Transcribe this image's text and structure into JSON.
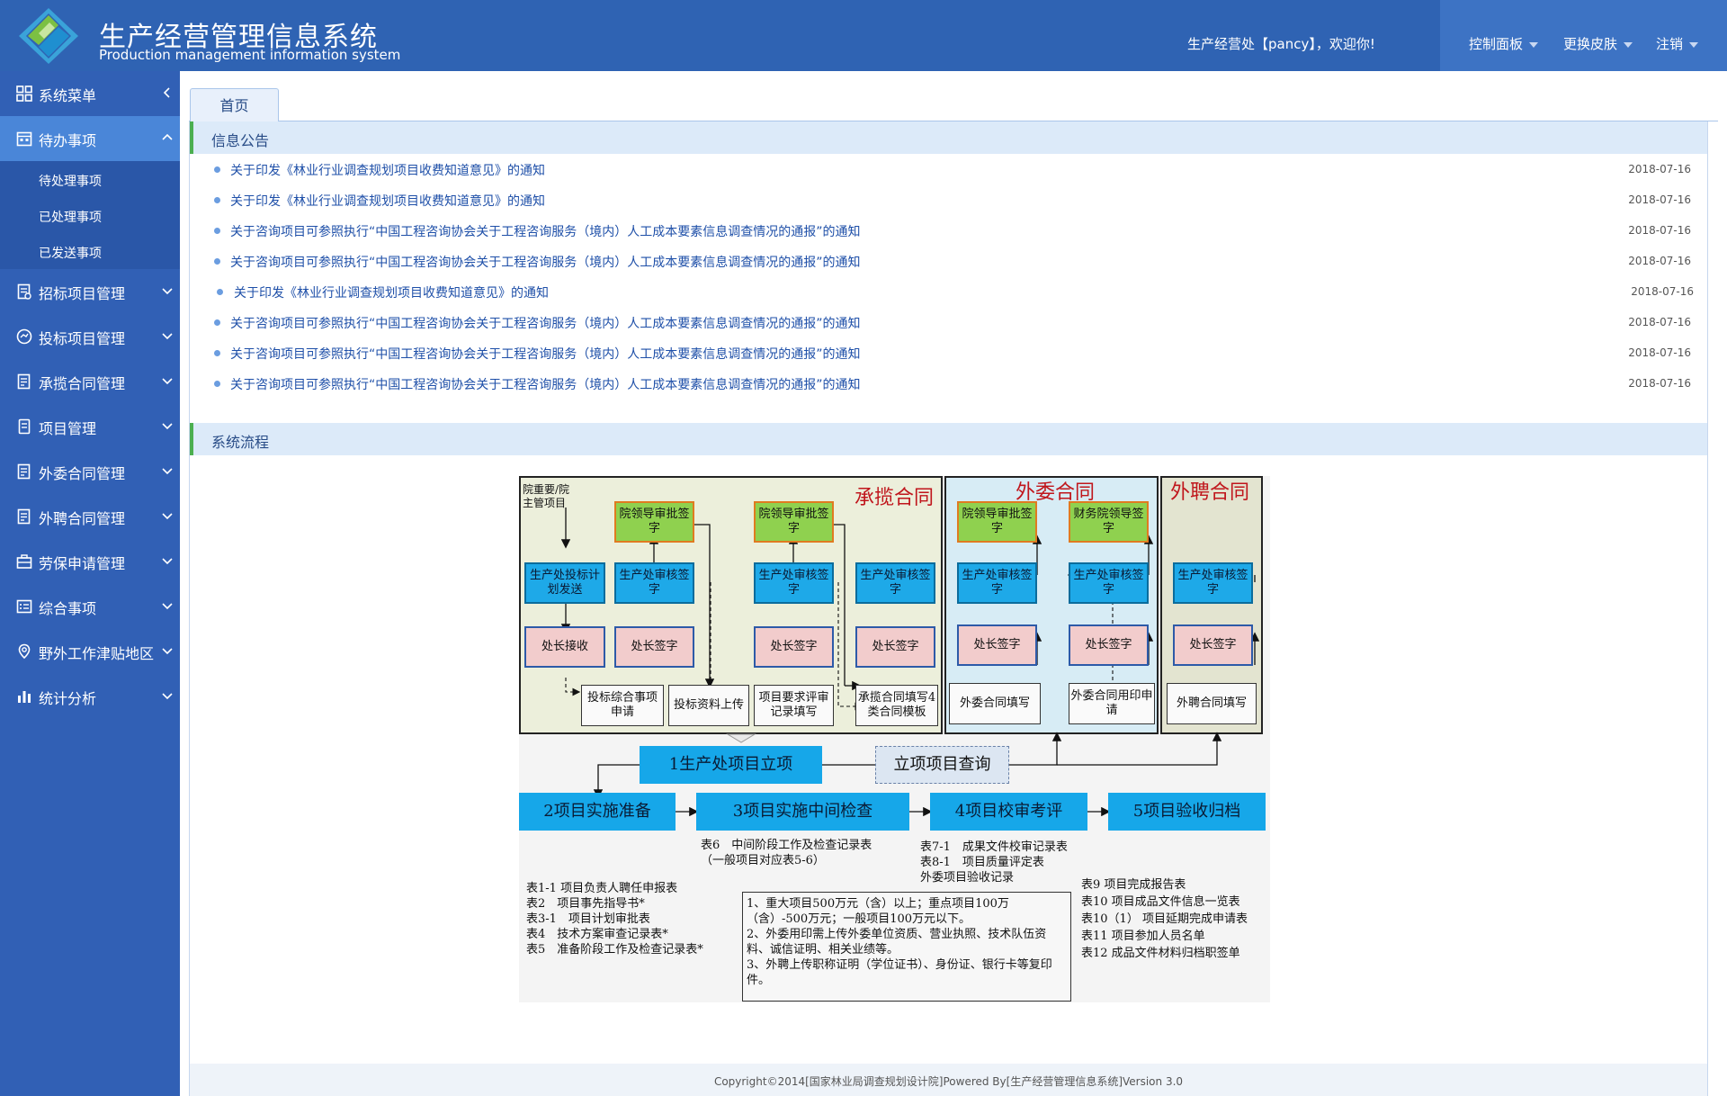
{
  "header": {
    "title": "生产经营管理信息系统",
    "subtitle": "Production management information system",
    "welcome": "生产经营处【pancy】，欢迎你!",
    "menu": [
      "控制面板",
      "更换皮肤",
      "注销"
    ]
  },
  "sidebar": {
    "items": [
      {
        "label": "系统菜单",
        "icon": "grid-icon"
      },
      {
        "label": "待办事项",
        "icon": "calendar-icon"
      },
      {
        "label": "招标项目管理",
        "icon": "document-icon"
      },
      {
        "label": "投标项目管理",
        "icon": "hand-icon"
      },
      {
        "label": "承揽合同管理",
        "icon": "contract-icon"
      },
      {
        "label": "项目管理",
        "icon": "folder-icon"
      },
      {
        "label": "外委合同管理",
        "icon": "contract-icon"
      },
      {
        "label": "外聘合同管理",
        "icon": "contract-icon"
      },
      {
        "label": "劳保申请管理",
        "icon": "briefcase-icon"
      },
      {
        "label": "综合事项",
        "icon": "list-icon"
      },
      {
        "label": "野外工作津贴地区",
        "icon": "location-icon"
      },
      {
        "label": "统计分析",
        "icon": "bar-chart-icon"
      }
    ],
    "sub_items": [
      "待处理事项",
      "已处理事项",
      "已发送事项"
    ]
  },
  "tabs": [
    {
      "label": "首页"
    }
  ],
  "notice": {
    "heading": "信息公告",
    "items": [
      {
        "title": "关于印发《林业行业调查规划项目收费知道意见》的通知",
        "date": "2018-07-16"
      },
      {
        "title": "关于印发《林业行业调查规划项目收费知道意见》的通知",
        "date": "2018-07-16"
      },
      {
        "title": "关于咨询项目可参照执行“中国工程咨询协会关于工程咨询服务（境内）人工成本要素信息调查情况的通报”的通知",
        "date": "2018-07-16"
      },
      {
        "title": "关于咨询项目可参照执行“中国工程咨询协会关于工程咨询服务（境内）人工成本要素信息调查情况的通报”的通知",
        "date": "2018-07-16"
      },
      {
        "title": "关于印发《林业行业调查规划项目收费知道意见》的通知",
        "date": "2018-07-16"
      },
      {
        "title": "关于咨询项目可参照执行“中国工程咨询协会关于工程咨询服务（境内）人工成本要素信息调查情况的通报”的通知",
        "date": "2018-07-16"
      },
      {
        "title": "关于咨询项目可参照执行“中国工程咨询协会关于工程咨询服务（境内）人工成本要素信息调查情况的通报”的通知",
        "date": "2018-07-16"
      },
      {
        "title": "关于咨询项目可参照执行“中国工程咨询协会关于工程咨询服务（境内）人工成本要素信息调查情况的通报”的通知",
        "date": "2018-07-16"
      }
    ]
  },
  "flow": {
    "heading": "系统流程",
    "panels": [
      "承揽合同",
      "外委合同",
      "外聘合同"
    ],
    "source_label": "院重要/院主管项目",
    "approve_lead": "院领导审批签字",
    "finance_lead": "财务院领导签字",
    "plan_send": "生产处投标计划发送",
    "review_sign": "生产处审核签字",
    "chief_receive": "处长接收",
    "chief_sign": "处长签字",
    "bid_apply": "投标综合事项申请",
    "bid_upload": "投标资料上传",
    "req_review": "项目要求评审记录填写",
    "contract_fill": "承揽合同填写4类合同模板",
    "outsource_fill": "外委合同填写",
    "outsource_seal": "外委合同用印申请",
    "hire_fill": "外聘合同填写",
    "step1": "1生产处项目立项",
    "query": "立项项目查询",
    "step2": "2项目实施准备",
    "step3": "3项目实施中间检查",
    "step4": "4项目校审考评",
    "step5": "5项目验收归档",
    "step3_docs": [
      "表6　中间阶段工作及检查记录表",
      "（一般项目对应表5-6）"
    ],
    "step4_docs": [
      "表7-1　成果文件校审记录表",
      "表8-1　项目质量评定表",
      "外委项目验收记录"
    ],
    "step2_docs": [
      "表1-1  项目负责人聘任申报表",
      "表2　项目事先指导书*",
      "表3-1　项目计划审批表",
      "表4　技术方案审查记录表*",
      "表5　准备阶段工作及检查记录表*"
    ],
    "notes": [
      "1、重大项目500万元（含）以上；重点项目100万（含）-500万元；一般项目100万元以下。",
      "2、外委用印需上传外委单位资质、营业执照、技术队伍资料、诚信证明、相关业绩等。",
      "3、外聘上传职称证明（学位证书）、身份证、银行卡等复印件。"
    ],
    "step5_docs": [
      "表9  项目完成报告表",
      "表10  项目成品文件信息一览表",
      "表10（1）  项目延期完成申请表",
      "表11  项目参加人员名单",
      "表12  成品文件材料归档职签单"
    ]
  },
  "footer": "Copyright©2014[国家林业局调查规划设计院]Powered By[生产经营管理信息系统]Version 3.0",
  "colors": {
    "header": "#2f63b3",
    "sidebar": "#3160b5",
    "active": "#4a86d8",
    "link": "#1e4fa8",
    "accent": "#4caf50"
  }
}
